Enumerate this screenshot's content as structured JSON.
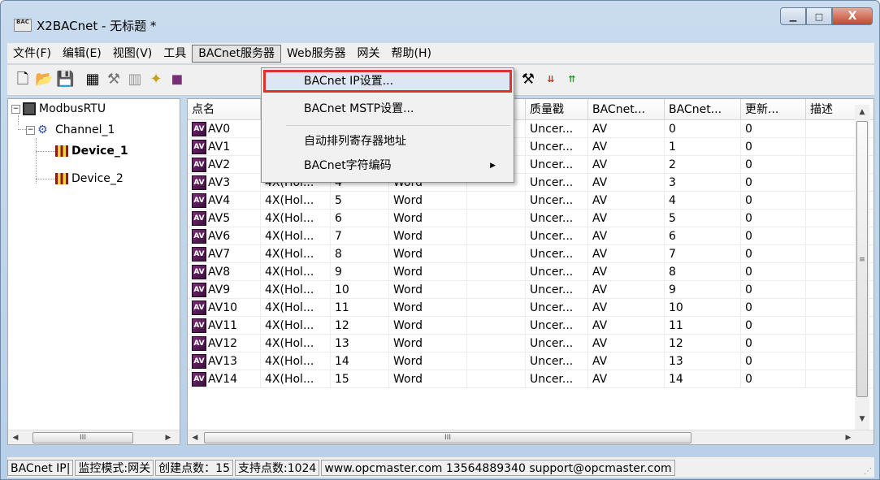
{
  "window": {
    "title": "X2BACnet - 无标题 *",
    "icon_text": "BAC",
    "minimize_glyph": "▁",
    "maximize_glyph": "□",
    "close_glyph": "X"
  },
  "menu": [
    "文件(F)",
    "编辑(E)",
    "视图(V)",
    "工具",
    "BACnet服务器",
    "Web服务器",
    "网关",
    "帮助(H)"
  ],
  "active_menu_index": 4,
  "dropdown": {
    "items": [
      {
        "label": "BACnet IP设置...",
        "highlighted": true
      },
      {
        "label": "BACnet MSTP设置...",
        "highlighted": false
      },
      {
        "label": "自动排列寄存器地址",
        "highlighted": false
      },
      {
        "label": "BACnet字符编码",
        "highlighted": false,
        "submenu_arrow": "▶"
      }
    ]
  },
  "toolbar": {
    "icons": [
      "new-icon",
      "open-icon",
      "save-icon",
      "modbus-icon",
      "channel-icon",
      "device-icon",
      "add-icon",
      "export-icon",
      "tools-icon",
      "load-icon",
      "up-icon"
    ]
  },
  "tree": {
    "root": "ModbusRTU",
    "channel": "Channel_1",
    "devices": [
      "Device_1",
      "Device_2"
    ],
    "expander_minus": "−",
    "selected_device": "Device_1"
  },
  "grid": {
    "headers": [
      "点名",
      "",
      "",
      "",
      "",
      "质量戳",
      "BACnet...",
      "BACnet...",
      "更新...",
      "描述"
    ],
    "rows": [
      [
        "AV0",
        "",
        "",
        "",
        "",
        "Uncer...",
        "AV",
        "0",
        "0"
      ],
      [
        "AV1",
        "",
        "",
        "",
        "",
        "Uncer...",
        "AV",
        "1",
        "0"
      ],
      [
        "AV2",
        "",
        "",
        "",
        "",
        "Uncer...",
        "AV",
        "2",
        "0"
      ],
      [
        "AV3",
        "4X(Hol...",
        "4",
        "Word",
        "",
        "Uncer...",
        "AV",
        "3",
        "0"
      ],
      [
        "AV4",
        "4X(Hol...",
        "5",
        "Word",
        "",
        "Uncer...",
        "AV",
        "4",
        "0"
      ],
      [
        "AV5",
        "4X(Hol...",
        "6",
        "Word",
        "",
        "Uncer...",
        "AV",
        "5",
        "0"
      ],
      [
        "AV6",
        "4X(Hol...",
        "7",
        "Word",
        "",
        "Uncer...",
        "AV",
        "6",
        "0"
      ],
      [
        "AV7",
        "4X(Hol...",
        "8",
        "Word",
        "",
        "Uncer...",
        "AV",
        "7",
        "0"
      ],
      [
        "AV8",
        "4X(Hol...",
        "9",
        "Word",
        "",
        "Uncer...",
        "AV",
        "8",
        "0"
      ],
      [
        "AV9",
        "4X(Hol...",
        "10",
        "Word",
        "",
        "Uncer...",
        "AV",
        "9",
        "0"
      ],
      [
        "AV10",
        "4X(Hol...",
        "11",
        "Word",
        "",
        "Uncer...",
        "AV",
        "10",
        "0"
      ],
      [
        "AV11",
        "4X(Hol...",
        "12",
        "Word",
        "",
        "Uncer...",
        "AV",
        "11",
        "0"
      ],
      [
        "AV12",
        "4X(Hol...",
        "13",
        "Word",
        "",
        "Uncer...",
        "AV",
        "12",
        "0"
      ],
      [
        "AV13",
        "4X(Hol...",
        "14",
        "Word",
        "",
        "Uncer...",
        "AV",
        "13",
        "0"
      ],
      [
        "AV14",
        "4X(Hol...",
        "15",
        "Word",
        "",
        "Uncer...",
        "AV",
        "14",
        "0"
      ]
    ],
    "av_icon_text": "AV"
  },
  "scroll": {
    "left_arrow": "◀",
    "right_arrow": "▶",
    "up_arrow": "▲",
    "down_arrow": "▼",
    "thumb_grip": "III",
    "vthumb_grip": "≡"
  },
  "status": [
    "BACnet IP|",
    "监控模式:网关",
    "创建点数：15",
    "支持点数:1024",
    "www.opcmaster.com 13564889340 support@opcmaster.com"
  ],
  "colors": {
    "highlight_border": "#e0322c",
    "av_icon": "#5a1f58"
  }
}
